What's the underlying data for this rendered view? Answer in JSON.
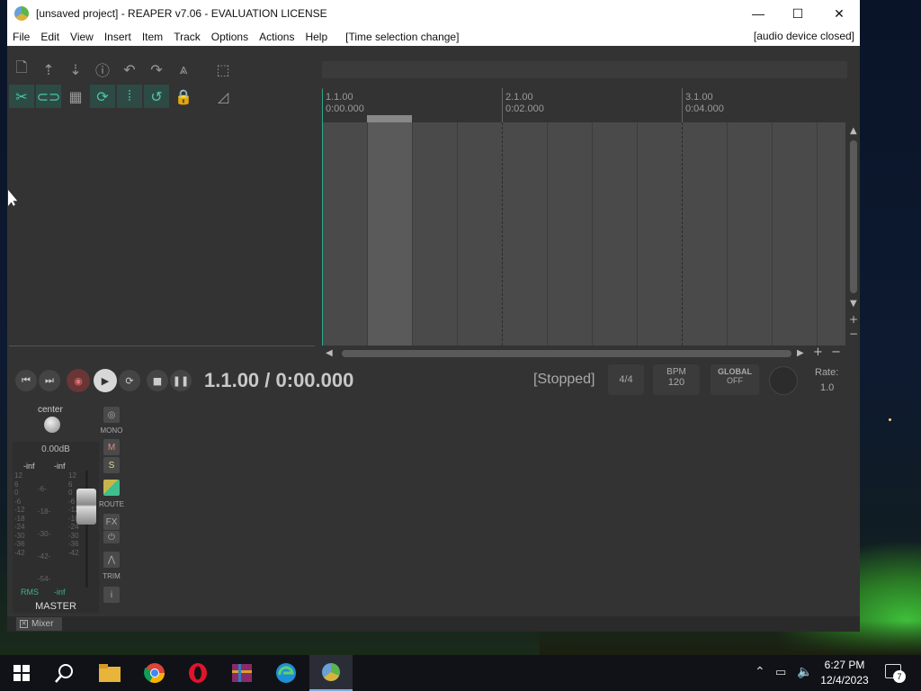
{
  "window": {
    "title": "[unsaved project] - REAPER v7.06 - EVALUATION LICENSE",
    "controls": {
      "minimize": "—",
      "maximize": "☐",
      "close": "✕"
    }
  },
  "menubar": {
    "items": [
      "File",
      "Edit",
      "View",
      "Insert",
      "Item",
      "Track",
      "Options",
      "Actions",
      "Help"
    ],
    "status": "[Time selection change]",
    "audio_status": "[audio device closed]"
  },
  "toolbar": {
    "row1": [
      "new-project-icon",
      "open-project-icon",
      "save-project-icon",
      "project-settings-icon",
      "undo-icon",
      "redo-icon",
      "metronome-icon"
    ],
    "row2": [
      "ripple-edit-icon",
      "auto-crossfade-icon",
      "snap-grid-icon",
      "locking-icon",
      "envelope-link-icon",
      "grouping-icon",
      "lock-icon"
    ]
  },
  "ruler": {
    "markers": [
      {
        "bar": "1.1.00",
        "time": "0:00.000"
      },
      {
        "bar": "2.1.00",
        "time": "0:02.000"
      },
      {
        "bar": "3.1.00",
        "time": "0:04.000"
      }
    ]
  },
  "transport": {
    "position": "1.1.00 / 0:00.000",
    "state": "[Stopped]",
    "time_signature": "4/4",
    "bpm_label": "BPM",
    "bpm_value": "120",
    "global_label": "GLOBAL",
    "global_value": "OFF",
    "rate_label": "Rate:",
    "rate_value": "1.0"
  },
  "master": {
    "pan": "center",
    "volume": "0.00dB",
    "peak_left": "-inf",
    "peak_right": "-inf",
    "scale_left": [
      "12",
      "6",
      "0",
      "-6",
      "-12",
      "-18",
      "-24",
      "-30",
      "-36",
      "-42"
    ],
    "scale_mid": [
      "-6-",
      "-18-",
      "-30-",
      "-42-",
      "-54-"
    ],
    "scale_right": [
      "12",
      "6",
      "0",
      "-6",
      "-12",
      "-18",
      "-24",
      "-30",
      "-36",
      "-42"
    ],
    "rms_label": "RMS",
    "rms_value": "-inf",
    "name": "MASTER",
    "mono_label": "MONO",
    "mute_label": "M",
    "solo_label": "S",
    "route_label": "ROUTE",
    "fx_label": "FX",
    "trim_label": "TRIM",
    "info_label": "i"
  },
  "mixer": {
    "tab_label": "Mixer"
  },
  "taskbar": {
    "apps": [
      "start-icon",
      "search-icon",
      "file-explorer-icon",
      "chrome-icon",
      "opera-icon",
      "winrar-icon",
      "edge-icon",
      "reaper-icon"
    ],
    "time": "6:27 PM",
    "date": "12/4/2023",
    "notification_count": "7"
  }
}
